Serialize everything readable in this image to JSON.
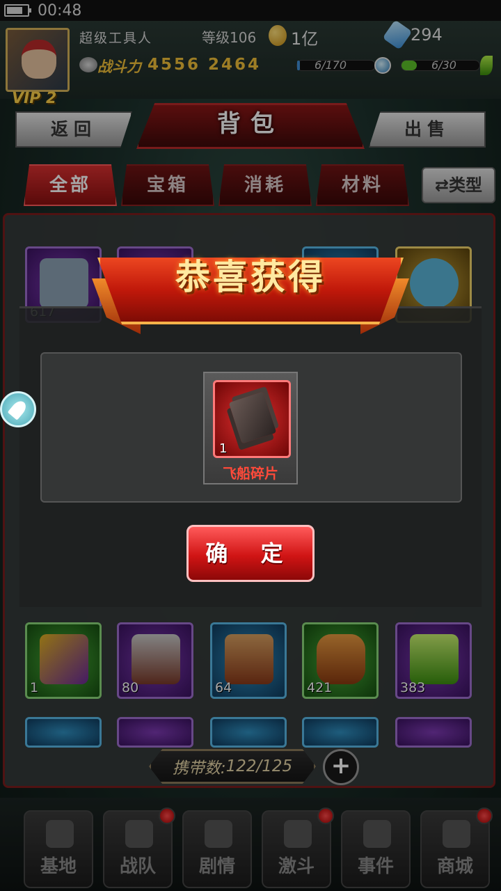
{
  "status_bar": {
    "time": "00:48",
    "battery_level": 0.8
  },
  "player": {
    "name": "超级工具人",
    "level_text": "等级106",
    "gold": "1亿",
    "gems": "294",
    "vip": "VIP 2",
    "power_label": "战斗力",
    "power_value": "4556 2464",
    "energy_text": "6/170",
    "energy_fraction": 0.035,
    "stamina_text": "6/30",
    "stamina_fraction": 0.2
  },
  "header": {
    "title": "背包",
    "back_label": "返回",
    "sell_label": "出售"
  },
  "tabs": [
    {
      "label": "全部",
      "active": true
    },
    {
      "label": "宝箱",
      "active": false
    },
    {
      "label": "消耗",
      "active": false
    },
    {
      "label": "材料",
      "active": false
    }
  ],
  "type_button": "⇄类型",
  "inventory": {
    "row_top": [
      {
        "count": "617",
        "rarity": "purple"
      },
      {
        "count": "",
        "rarity": "purple"
      },
      {
        "count": "",
        "rarity": "blue"
      },
      {
        "count": "",
        "rarity": "blue"
      },
      {
        "count": "",
        "rarity": "gold"
      }
    ],
    "row_bottom": [
      {
        "count": "1",
        "rarity": "green"
      },
      {
        "count": "80",
        "rarity": "purple"
      },
      {
        "count": "64",
        "rarity": "blue"
      },
      {
        "count": "421",
        "rarity": "green"
      },
      {
        "count": "383",
        "rarity": "purple"
      }
    ],
    "capacity_label": "携带数:",
    "capacity_value": "122/125"
  },
  "bottom_nav": [
    {
      "label": "基地",
      "dot": false
    },
    {
      "label": "战队",
      "dot": true
    },
    {
      "label": "剧情",
      "dot": false
    },
    {
      "label": "激斗",
      "dot": true
    },
    {
      "label": "事件",
      "dot": false
    },
    {
      "label": "商城",
      "dot": true
    }
  ],
  "reward_modal": {
    "title": "恭喜获得",
    "item_name": "飞船碎片",
    "item_count": "1",
    "confirm_label": "确 定"
  },
  "colors": {
    "accent_red": "#d01414",
    "gold_text": "#f2c13a",
    "rarity_red": "#e33030"
  }
}
